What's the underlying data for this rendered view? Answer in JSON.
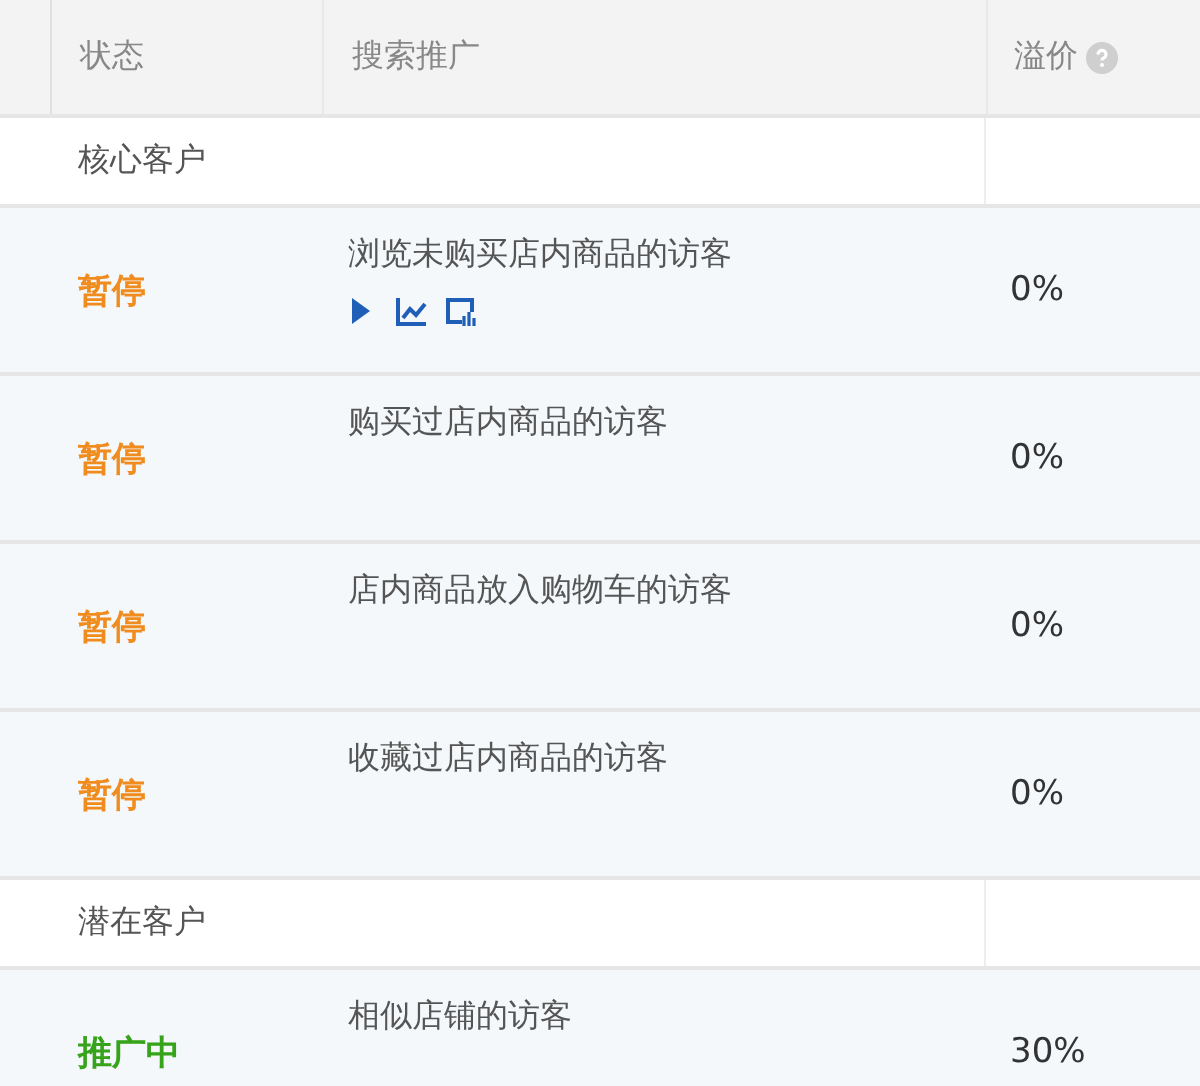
{
  "table": {
    "columns": [
      "状态",
      "搜索推广",
      "溢价"
    ],
    "rows": [
      {
        "kind": "group",
        "label": "核心客户"
      },
      {
        "kind": "audience",
        "status": {
          "text": "暂停",
          "color": "#f08c1e"
        },
        "name": "浏览未购买店内商品的访客",
        "tools_shown": true,
        "premium": "0%"
      },
      {
        "kind": "audience",
        "status": {
          "text": "暂停",
          "color": "#f08c1e"
        },
        "name": "购买过店内商品的访客",
        "tools_shown": false,
        "premium": "0%"
      },
      {
        "kind": "audience",
        "status": {
          "text": "暂停",
          "color": "#f08c1e"
        },
        "name": "店内商品放入购物车的访客",
        "tools_shown": false,
        "premium": "0%"
      },
      {
        "kind": "audience",
        "status": {
          "text": "暂停",
          "color": "#f08c1e"
        },
        "name": "收藏过店内商品的访客",
        "tools_shown": false,
        "premium": "0%"
      },
      {
        "kind": "group",
        "label": "潜在客户"
      },
      {
        "kind": "audience",
        "status": {
          "text": "推广中",
          "color": "#36a31b"
        },
        "name": "相似店铺的访客",
        "tools_shown": false,
        "premium": "30%"
      }
    ]
  }
}
